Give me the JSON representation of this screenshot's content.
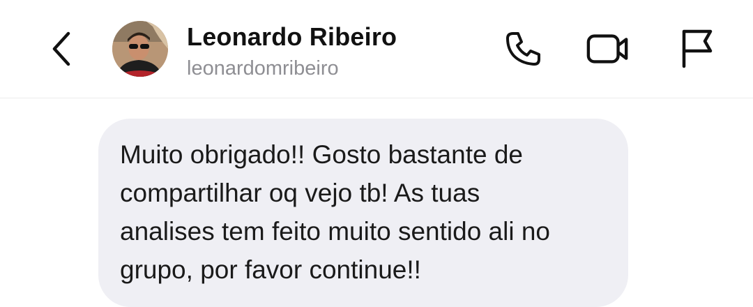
{
  "header": {
    "contact_name": "Leonardo Ribeiro",
    "contact_username": "leonardomribeiro",
    "icons": {
      "back": "chevron-left-icon",
      "call": "phone-icon",
      "video": "video-camera-icon",
      "report": "flag-icon"
    }
  },
  "messages": [
    {
      "direction": "incoming",
      "text": "Muito obrigado!! Gosto bastante de\ncompartilhar oq vejo tb! As tuas\nanalises tem feito muito sentido ali no\ngrupo, por favor continue!!"
    }
  ],
  "colors": {
    "bubble_incoming": "#efeff4",
    "text_primary": "#111111",
    "text_secondary": "#8e8e93"
  }
}
